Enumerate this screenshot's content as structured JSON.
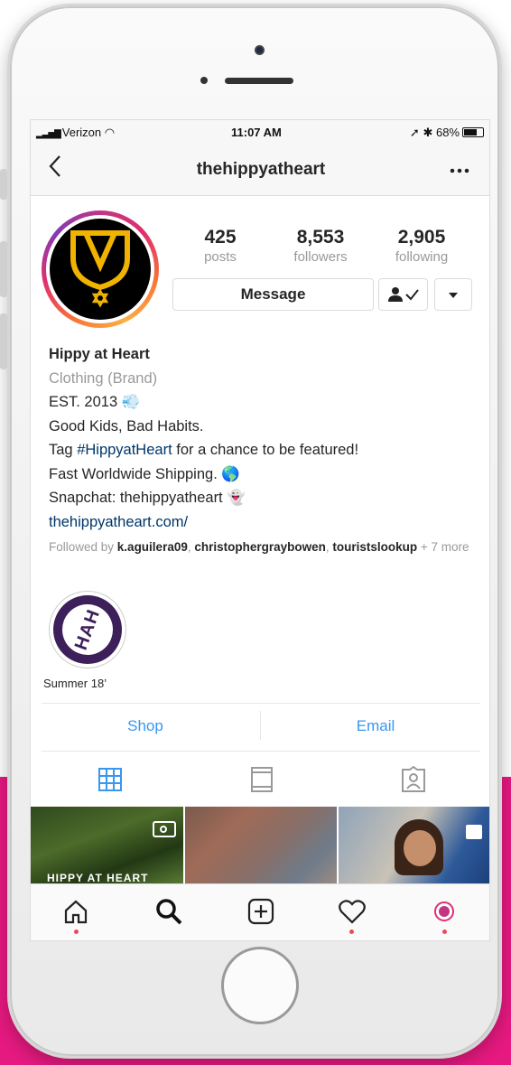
{
  "status_bar": {
    "carrier": "Verizon",
    "time": "11:07 AM",
    "battery": "68%"
  },
  "nav": {
    "title": "thehippyatheart",
    "back_icon": "chevron-left-icon",
    "more_icon": "ellipsis-icon"
  },
  "stats": {
    "posts": {
      "value": "425",
      "label": "posts"
    },
    "followers": {
      "value": "8,553",
      "label": "followers"
    },
    "following": {
      "value": "2,905",
      "label": "following"
    }
  },
  "buttons": {
    "message": "Message",
    "following_icon": "person-check-icon",
    "dropdown_icon": "triangle-down-icon"
  },
  "bio": {
    "name": "Hippy at Heart",
    "category": "Clothing (Brand)",
    "line1": "EST. 2013",
    "line2": "Good Kids, Bad Habits.",
    "line3_pre": "Tag ",
    "line3_tag": "#HippyatHeart",
    "line3_post": " for a chance to be featured!",
    "line4": "Fast Worldwide Shipping.",
    "line5": "Snapchat: thehippyatheart",
    "website": "thehippyatheart.com/"
  },
  "followed_by": {
    "prefix": "Followed by ",
    "user1": "k.aguilera09",
    "sep": ", ",
    "user2": "christophergraybowen",
    "sep2": ", ",
    "user3": "touristslookup",
    "more": " + 7 more"
  },
  "highlight": {
    "label": "Summer 18’",
    "badge_text": "HAH"
  },
  "actions": {
    "shop": "Shop",
    "email": "Email"
  },
  "grid": {
    "cell1_caption": "HIPPY AT HEART"
  },
  "colors": {
    "accent_blue": "#3897f0",
    "link_blue": "#003569",
    "muted_gray": "#999999",
    "notification_red": "#ed4956",
    "background_pink": "#e5197f"
  }
}
